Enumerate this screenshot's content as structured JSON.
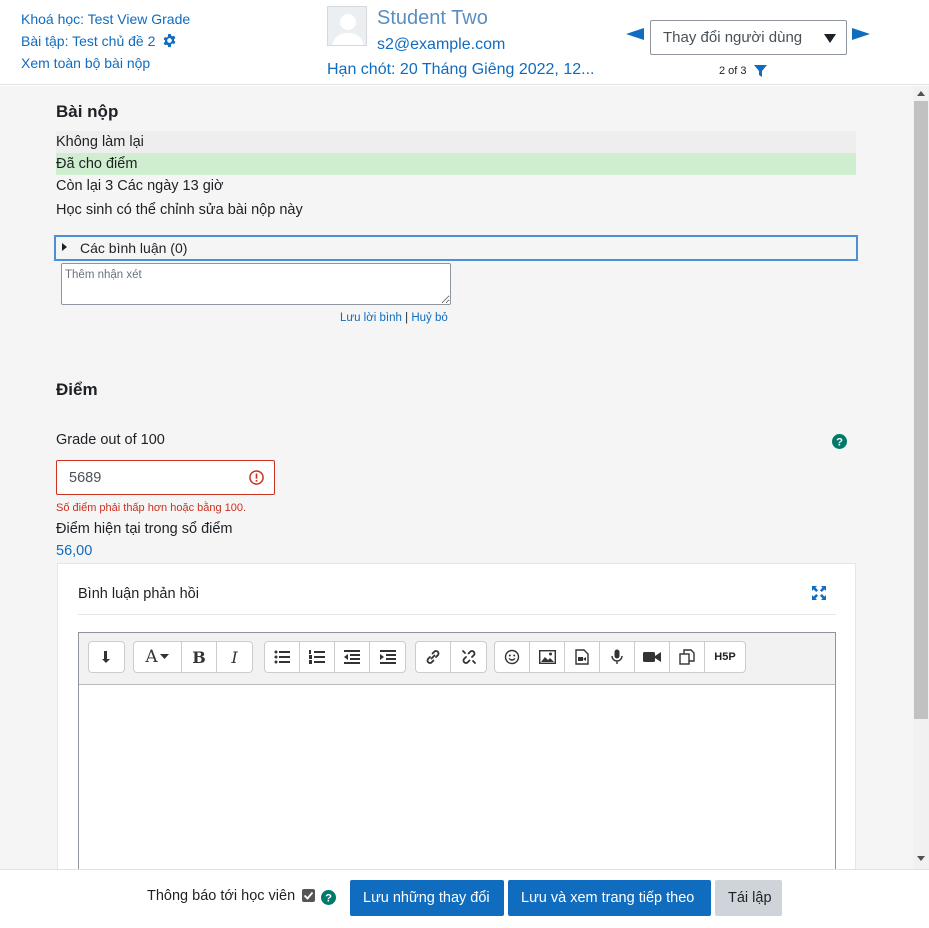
{
  "header": {
    "course_link": "Khoá học: Test View Grade",
    "assignment_link": "Bài tập: Test chủ đề 2",
    "view_all_link": "Xem toàn bộ bài nộp",
    "user_name": "Student Two",
    "user_email": "s2@example.com",
    "due_date": "Hạn chót: 20 Tháng Giêng 2022, 12...",
    "user_select_value": "Thay đổi người dùng",
    "page_count": "2 of 3"
  },
  "submission": {
    "title": "Bài nộp",
    "attempt_status": "Không làm lại",
    "grading_status": "Đã cho điểm",
    "time_remaining": "Còn lại 3 Các ngày 13 giờ",
    "editable_note": "Học sinh có thể chỉnh sửa bài nộp này",
    "comments_toggle": "Các bình luận (0)",
    "comment_placeholder": "Thêm nhận xét",
    "save_comment": "Lưu lời bình",
    "separator": " | ",
    "cancel_comment": "Huỷ bỏ"
  },
  "grade": {
    "title": "Điểm",
    "label": "Grade out of 100",
    "value": "5689",
    "error": "Số điểm phải thấp hơn hoặc bằng 100.",
    "current_label": "Điểm hiện tại trong sổ điểm",
    "current_value": "56,00"
  },
  "feedback": {
    "label": "Bình luận phản hồi",
    "toolbar_groups": [
      [
        "collapse-icon"
      ],
      [
        "font-style-icon",
        "bold-icon",
        "italic-icon"
      ],
      [
        "bullet-list-icon",
        "numbered-list-icon",
        "outdent-icon",
        "indent-icon"
      ],
      [
        "link-icon",
        "unlink-icon"
      ],
      [
        "emoji-icon",
        "image-icon",
        "media-icon",
        "record-audio-icon",
        "record-video-icon",
        "manage-files-icon",
        "h5p-icon"
      ]
    ],
    "bold_glyph": "B",
    "italic_glyph": "I",
    "font_glyph": "A",
    "h5p_text": "H5P"
  },
  "footer": {
    "notify_label": "Thông báo tới học viên",
    "notify_checked": true,
    "save_button": "Lưu những thay đổi",
    "save_next_button": "Lưu và xem trang tiếp theo",
    "reset_button": "Tái lập"
  },
  "colors": {
    "brand": "#0f6cbf",
    "error": "#ca3120",
    "graded_bg": "#cfeecf",
    "help": "#00796b"
  }
}
